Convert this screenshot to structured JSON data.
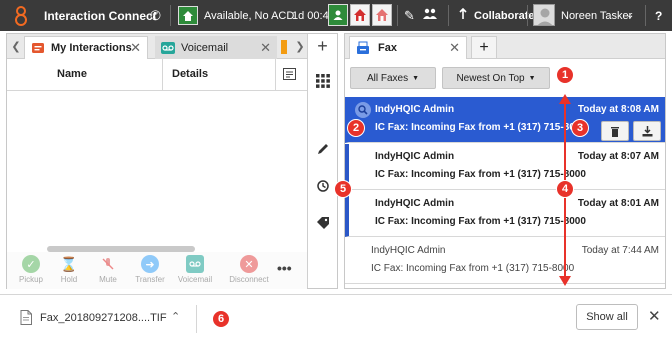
{
  "topbar": {
    "app_title": "Interaction Connect",
    "status_label": "Available, No ACD",
    "timer": "1d 00:4",
    "collaborate_label": "Collaborate",
    "user_name": "Noreen Tasker",
    "help": "?"
  },
  "left": {
    "tabs": [
      {
        "label": "My Interactions"
      },
      {
        "label": "Voicemail"
      }
    ],
    "columns": [
      "Name",
      "Details"
    ],
    "call_controls": [
      {
        "label": "Pickup"
      },
      {
        "label": "Hold"
      },
      {
        "label": "Mute"
      },
      {
        "label": "Transfer"
      },
      {
        "label": "Voicemail"
      },
      {
        "label": "Disconnect"
      }
    ],
    "more": "•••"
  },
  "right": {
    "tab_label": "Fax",
    "filter_label": "All Faxes",
    "sort_label": "Newest On Top",
    "messages": [
      {
        "from": "IndyHQIC Admin",
        "subject": "IC Fax: Incoming Fax from +1 (317) 715-8000",
        "time": "Today at 8:08 AM"
      },
      {
        "from": "IndyHQIC Admin",
        "subject": "IC Fax: Incoming Fax from +1 (317) 715-8000",
        "time": "Today at 8:07 AM"
      },
      {
        "from": "IndyHQIC Admin",
        "subject": "IC Fax: Incoming Fax from +1 (317) 715-8000",
        "time": "Today at 8:01 AM"
      },
      {
        "from": "IndyHQIC Admin",
        "subject": "IC Fax: Incoming Fax from +1 (317) 715-8000",
        "time": "Today at 7:44 AM"
      }
    ]
  },
  "annotations": [
    "1",
    "2",
    "3",
    "4",
    "5",
    "6"
  ],
  "download_bar": {
    "file_name": "Fax_201809271208....TIF",
    "show_all_label": "Show all"
  },
  "colors": {
    "topbar_bg": "#3a3a3a",
    "selected_row": "#2a5bd1",
    "unread_marker": "#2b57c7",
    "annotation_red": "#e8322a",
    "status_green": "#2e8b3a"
  }
}
